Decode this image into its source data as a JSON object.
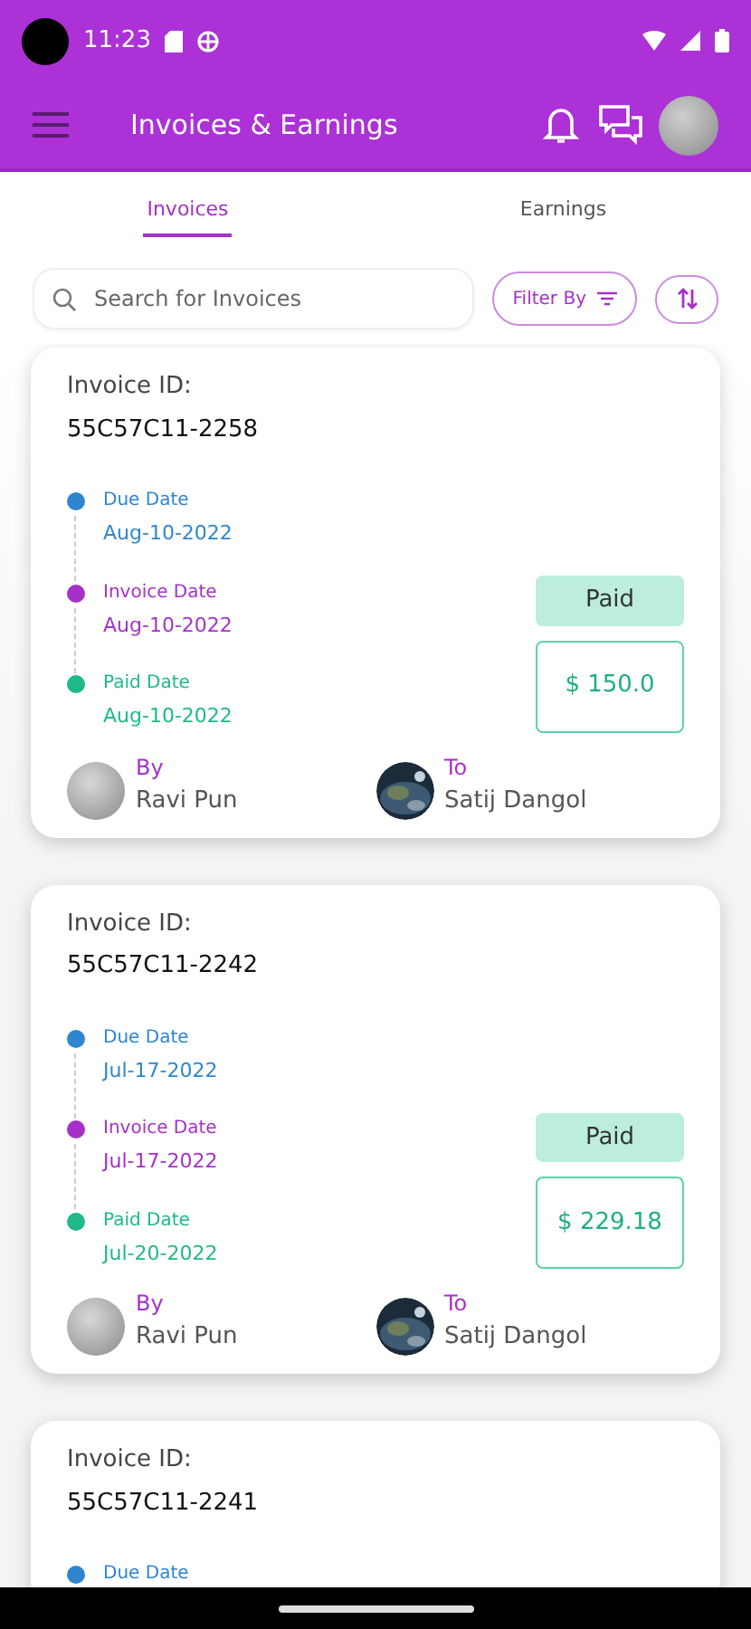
{
  "status_bar": {
    "time": "11:23"
  },
  "app_bar": {
    "title": "Invoices & Earnings"
  },
  "tabs": [
    {
      "label": "Invoices",
      "selected": true
    },
    {
      "label": "Earnings",
      "selected": false
    }
  ],
  "search": {
    "placeholder": "Search for Invoices"
  },
  "filter_button": {
    "label": "Filter By"
  },
  "invoices": [
    {
      "id_label": "Invoice ID:",
      "id": "55C57C11-2258",
      "dates": [
        {
          "label": "Due Date",
          "value": "Aug-10-2022",
          "color": "#2f86d0"
        },
        {
          "label": "Invoice Date",
          "value": "Aug-10-2022",
          "color": "#a531c9"
        },
        {
          "label": "Paid Date",
          "value": "Aug-10-2022",
          "color": "#1fb98a"
        }
      ],
      "status": "Paid",
      "amount": "$ 150.0",
      "by_label": "By",
      "by_name": "Ravi Pun",
      "to_label": "To",
      "to_name": "Satij Dangol"
    },
    {
      "id_label": "Invoice ID:",
      "id": "55C57C11-2242",
      "dates": [
        {
          "label": "Due Date",
          "value": "Jul-17-2022",
          "color": "#2f86d0"
        },
        {
          "label": "Invoice Date",
          "value": "Jul-17-2022",
          "color": "#a531c9"
        },
        {
          "label": "Paid Date",
          "value": "Jul-20-2022",
          "color": "#1fb98a"
        }
      ],
      "status": "Paid",
      "amount": "$ 229.18",
      "by_label": "By",
      "by_name": "Ravi Pun",
      "to_label": "To",
      "to_name": "Satij Dangol"
    },
    {
      "id_label": "Invoice ID:",
      "id": "55C57C11-2241",
      "dates": [
        {
          "label": "Due Date",
          "color": "#2f86d0"
        }
      ]
    }
  ]
}
